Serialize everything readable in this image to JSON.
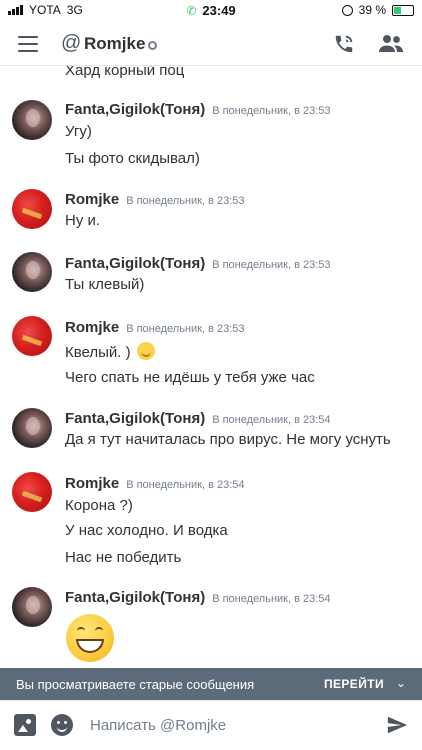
{
  "status_bar": {
    "carrier": "YOTA",
    "network": "3G",
    "time": "23:49",
    "battery": "39 %",
    "battery_level": 0.39
  },
  "header": {
    "at_symbol": "@",
    "title": "Romjke"
  },
  "messages": {
    "top_cut_text": "Хард корный  поц",
    "groups": [
      {
        "author": "Fanta,Gigilok(Тоня)",
        "timestamp": "В понедельник, в 23:53",
        "lines": [
          "Угу)",
          "Ты фото скидывал)"
        ]
      },
      {
        "author": "Romjke",
        "timestamp": "В понедельник, в 23:53",
        "lines": [
          "Ну и."
        ]
      },
      {
        "author": "Fanta,Gigilok(Тоня)",
        "timestamp": "В понедельник, в 23:53",
        "lines": [
          "Ты клевый)"
        ]
      },
      {
        "author": "Romjke",
        "timestamp": "В понедельник, в 23:53",
        "lines": [
          "Квелый. )",
          "Чего спать не идёшь у тебя уже час"
        ]
      },
      {
        "author": "Fanta,Gigilok(Тоня)",
        "timestamp": "В понедельник, в 23:54",
        "lines": [
          "Да я тут начиталась про вирус. Не могу уснуть"
        ]
      },
      {
        "author": "Romjke",
        "timestamp": "В понедельник, в 23:54",
        "lines": [
          "Корона ?)",
          "У нас холодно. И водка",
          "Нас не победить"
        ]
      },
      {
        "author": "Fanta,Gigilok(Тоня)",
        "timestamp": "В понедельник, в 23:54",
        "lines": []
      }
    ]
  },
  "old_messages_bar": {
    "text": "Вы просматриваете старые сообщения",
    "jump_label": "ПЕРЕЙТИ"
  },
  "composer": {
    "placeholder": "Написать @Romjke"
  },
  "icons": {
    "inline_emoji": "relieved-face-icon",
    "big_emoji": "grinning-face-icon"
  }
}
